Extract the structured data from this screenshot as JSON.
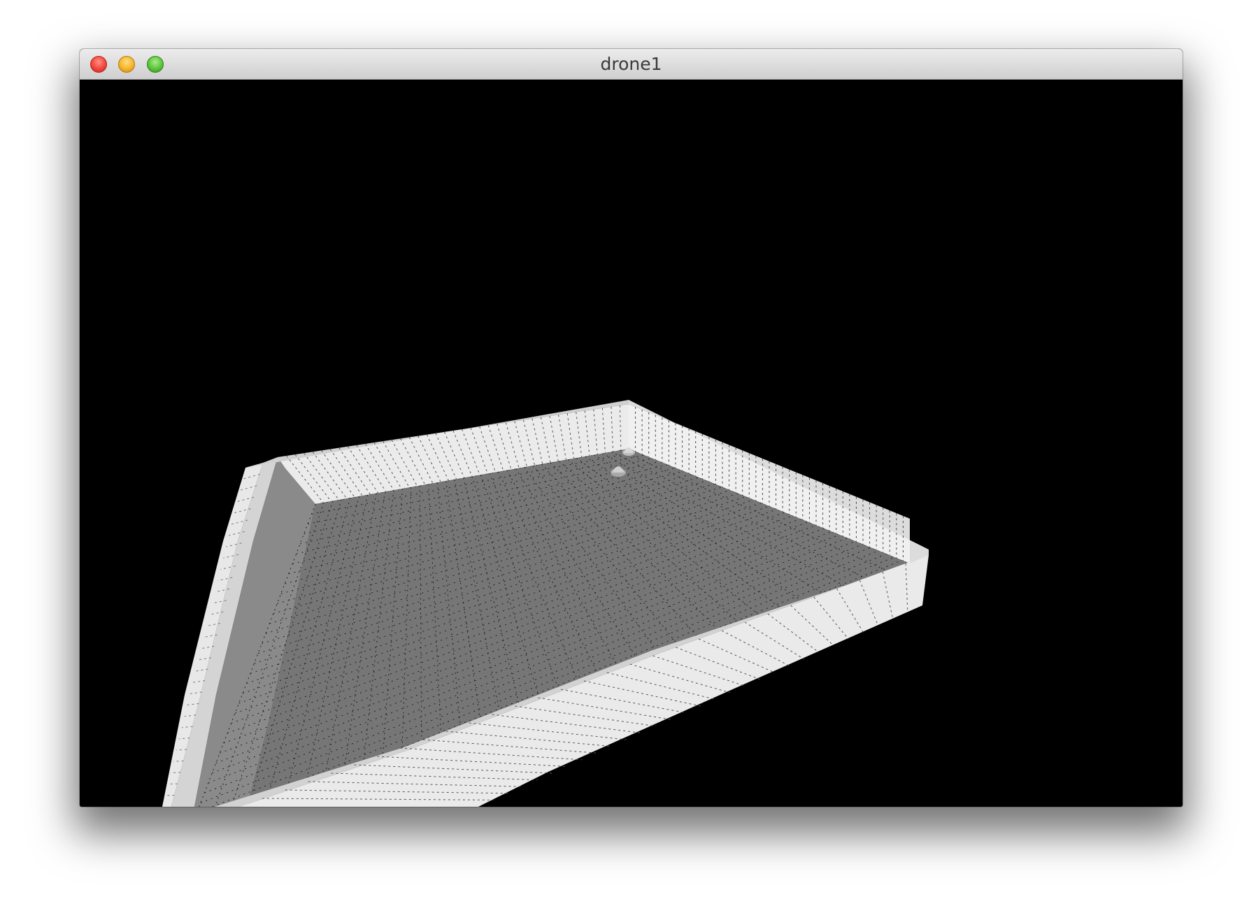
{
  "window": {
    "title": "drone1",
    "controls": {
      "close": "close-button",
      "minimize": "minimize-button",
      "zoom": "zoom-button"
    }
  },
  "scene": {
    "background_color": "#000000",
    "floor_color": "#767676",
    "wall_color": "#e6e6e6",
    "wall_top_color": "#d2d2d2",
    "grid_line_color": "#222222"
  }
}
